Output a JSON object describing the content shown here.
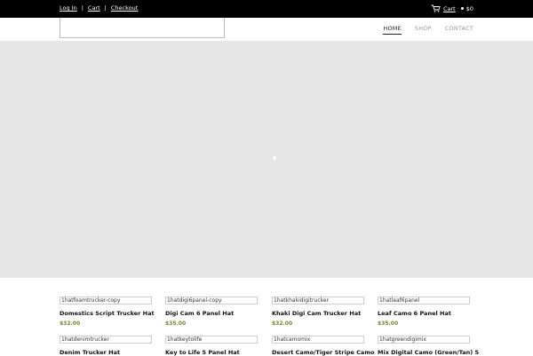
{
  "topbar": {
    "links": [
      "Log In",
      "Cart",
      "Checkout"
    ],
    "separator": "|",
    "cart_label": "Cart",
    "cart_total": "$0"
  },
  "nav": {
    "items": [
      {
        "label": "HOME",
        "active": true
      },
      {
        "label": "SHOP",
        "active": false
      },
      {
        "label": "CONTACT",
        "active": false
      }
    ]
  },
  "colors": {
    "topbar_bg": "#000000",
    "hero_bg": "#e6e6e6",
    "price": "#6e8b2b"
  },
  "products": [
    {
      "image_alt": "1hatfoamtrucker-copy",
      "name": "Domestics Script Trucker Hat",
      "price": "$32.00"
    },
    {
      "image_alt": "1hatdigi6panel-copy",
      "name": "Digi Cam 6 Panel Hat",
      "price": "$35.00"
    },
    {
      "image_alt": "1hatkhakidigitrucker",
      "name": "Khaki Digi Cam Trucker Hat",
      "price": "$32.00"
    },
    {
      "image_alt": "1hatleaf6panel",
      "name": "Leaf Camo 6 Panel Hat",
      "price": "$35.00"
    },
    {
      "image_alt": "1hatdenimtrucker",
      "name": "Denim Trucker Hat",
      "price": ""
    },
    {
      "image_alt": "1hatkeytolife",
      "name": "Key to Life 5 Panel Hat",
      "price": ""
    },
    {
      "image_alt": "1hatcamomix",
      "name": "Desert Camo/Tiger Stripe Camo",
      "price": ""
    },
    {
      "image_alt": "1hatgreendigimix",
      "name": "Mix Digital Camo (Green/Tan) 5",
      "price": ""
    }
  ]
}
